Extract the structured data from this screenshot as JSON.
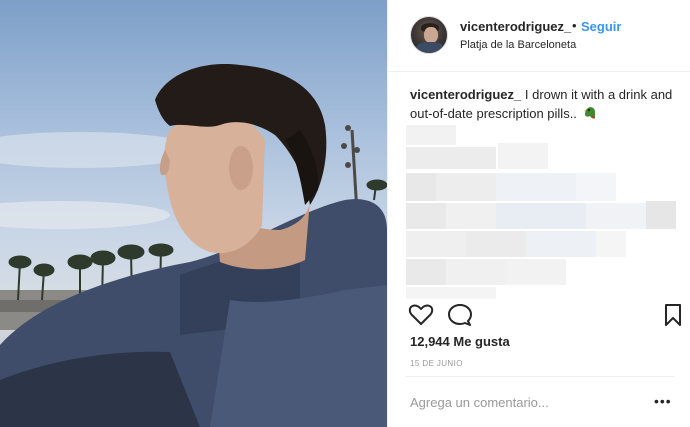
{
  "post": {
    "username": "vicenterodriguez_",
    "separator": "•",
    "follow_label": "Seguir",
    "location": "Platja de la Barceloneta",
    "caption_user": "vicenterodriguez_",
    "caption_text": " I drown it with a drink and out-of-date prescription pills..",
    "likes": "12,944 Me gusta",
    "date": "15 DE JUNIO",
    "comment_placeholder": "Agrega un comentario...",
    "more_label": "•••"
  },
  "icons": {
    "like": "heart-outline-icon",
    "comment": "comment-bubble-icon",
    "save": "bookmark-outline-icon",
    "caption_emoji": "parrot-emoji-icon",
    "menu": "more-options-icon"
  },
  "colors": {
    "accent": "#3897f0",
    "text": "#262626",
    "muted": "#999999",
    "border": "#efefef"
  }
}
